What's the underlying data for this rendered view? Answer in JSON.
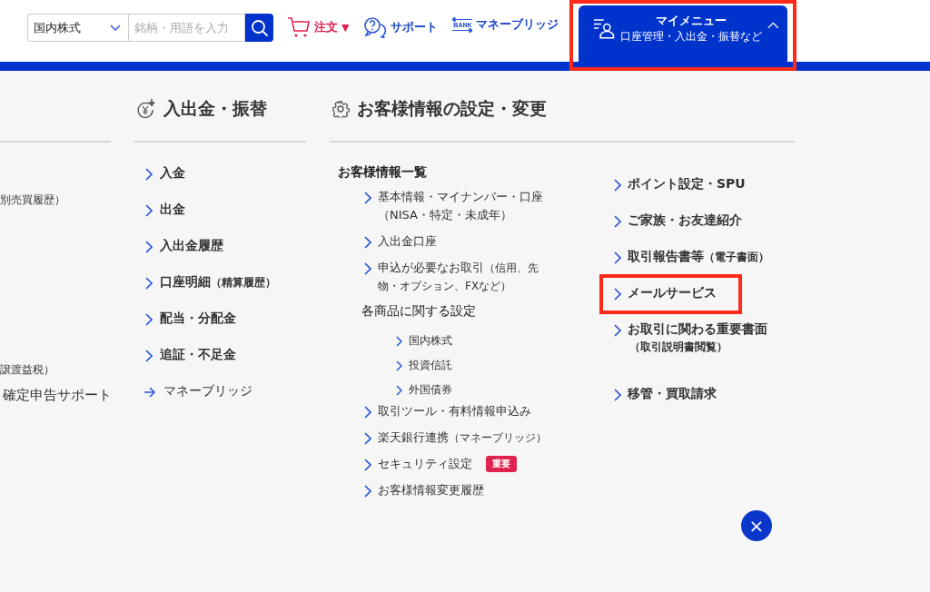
{
  "header": {
    "market_select": {
      "value": "国内株式"
    },
    "search": {
      "placeholder": "銘柄・用語を入力"
    },
    "nav": [
      {
        "kind": "order",
        "label": "注文",
        "caret": "▼"
      },
      {
        "kind": "support",
        "label": "サポート"
      },
      {
        "kind": "bank",
        "label": "マネーブリッジ",
        "icon_text": "BANK"
      }
    ],
    "my_menu": {
      "title": "マイメニュー",
      "subtitle": "口座管理・入出金・振替など",
      "expanded": true,
      "highlighted": true
    }
  },
  "left_column": {
    "items": [
      {
        "kind": "note",
        "label": "別売買履歴）"
      },
      {
        "kind": "note",
        "label": "譲渡益税）"
      },
      {
        "kind": "link",
        "label": "確定申告サポート"
      }
    ]
  },
  "deposit_column": {
    "title": "入出金・振替",
    "items": [
      {
        "kind": "link",
        "label": "入金"
      },
      {
        "kind": "link",
        "label": "出金"
      },
      {
        "kind": "link",
        "label": "入出金履歴"
      },
      {
        "kind": "link",
        "label": "口座明細",
        "note": "（精算履歴）"
      },
      {
        "kind": "link",
        "label": "配当・分配金"
      },
      {
        "kind": "link",
        "label": "追証・不足金"
      },
      {
        "kind": "external",
        "label": "マネーブリッジ"
      }
    ]
  },
  "settings_column": {
    "title": "お客様情報の設定・変更",
    "overview": {
      "heading": "お客様情報一覧",
      "items": [
        {
          "kind": "link",
          "label": "基本情報・マイナンバー・口座（NISA・特定・未成年）"
        },
        {
          "kind": "link",
          "label": "入出金口座"
        },
        {
          "kind": "link",
          "label": "申込が必要なお取引",
          "note": "（信用、先物・オプション、FXなど）"
        },
        {
          "kind": "group",
          "label": "各商品に関する設定",
          "children": [
            {
              "label": "国内株式"
            },
            {
              "label": "投資信託"
            },
            {
              "label": "外国債券"
            }
          ]
        },
        {
          "kind": "link",
          "label": "取引ツール・有料情報申込み"
        },
        {
          "kind": "link",
          "label": "楽天銀行連携",
          "note": "（マネーブリッジ）"
        },
        {
          "kind": "link",
          "label": "セキュリティ設定",
          "badge": "重要"
        },
        {
          "kind": "link",
          "label": "お客様情報変更履歴"
        }
      ]
    },
    "other_items": [
      {
        "label": "ポイント設定・SPU",
        "highlighted": false
      },
      {
        "label": "ご家族・お友達紹介",
        "highlighted": false
      },
      {
        "label": "取引報告書等",
        "note": "（電子書面）",
        "highlighted": false
      },
      {
        "label": "メールサービス",
        "highlighted": true
      },
      {
        "label": "お取引に関わる重要書面",
        "subnote": "（取引説明書閲覧）",
        "highlighted": false
      },
      {
        "label": "移管・買取請求",
        "highlighted": false
      }
    ]
  },
  "close_button": {
    "label": "×"
  }
}
